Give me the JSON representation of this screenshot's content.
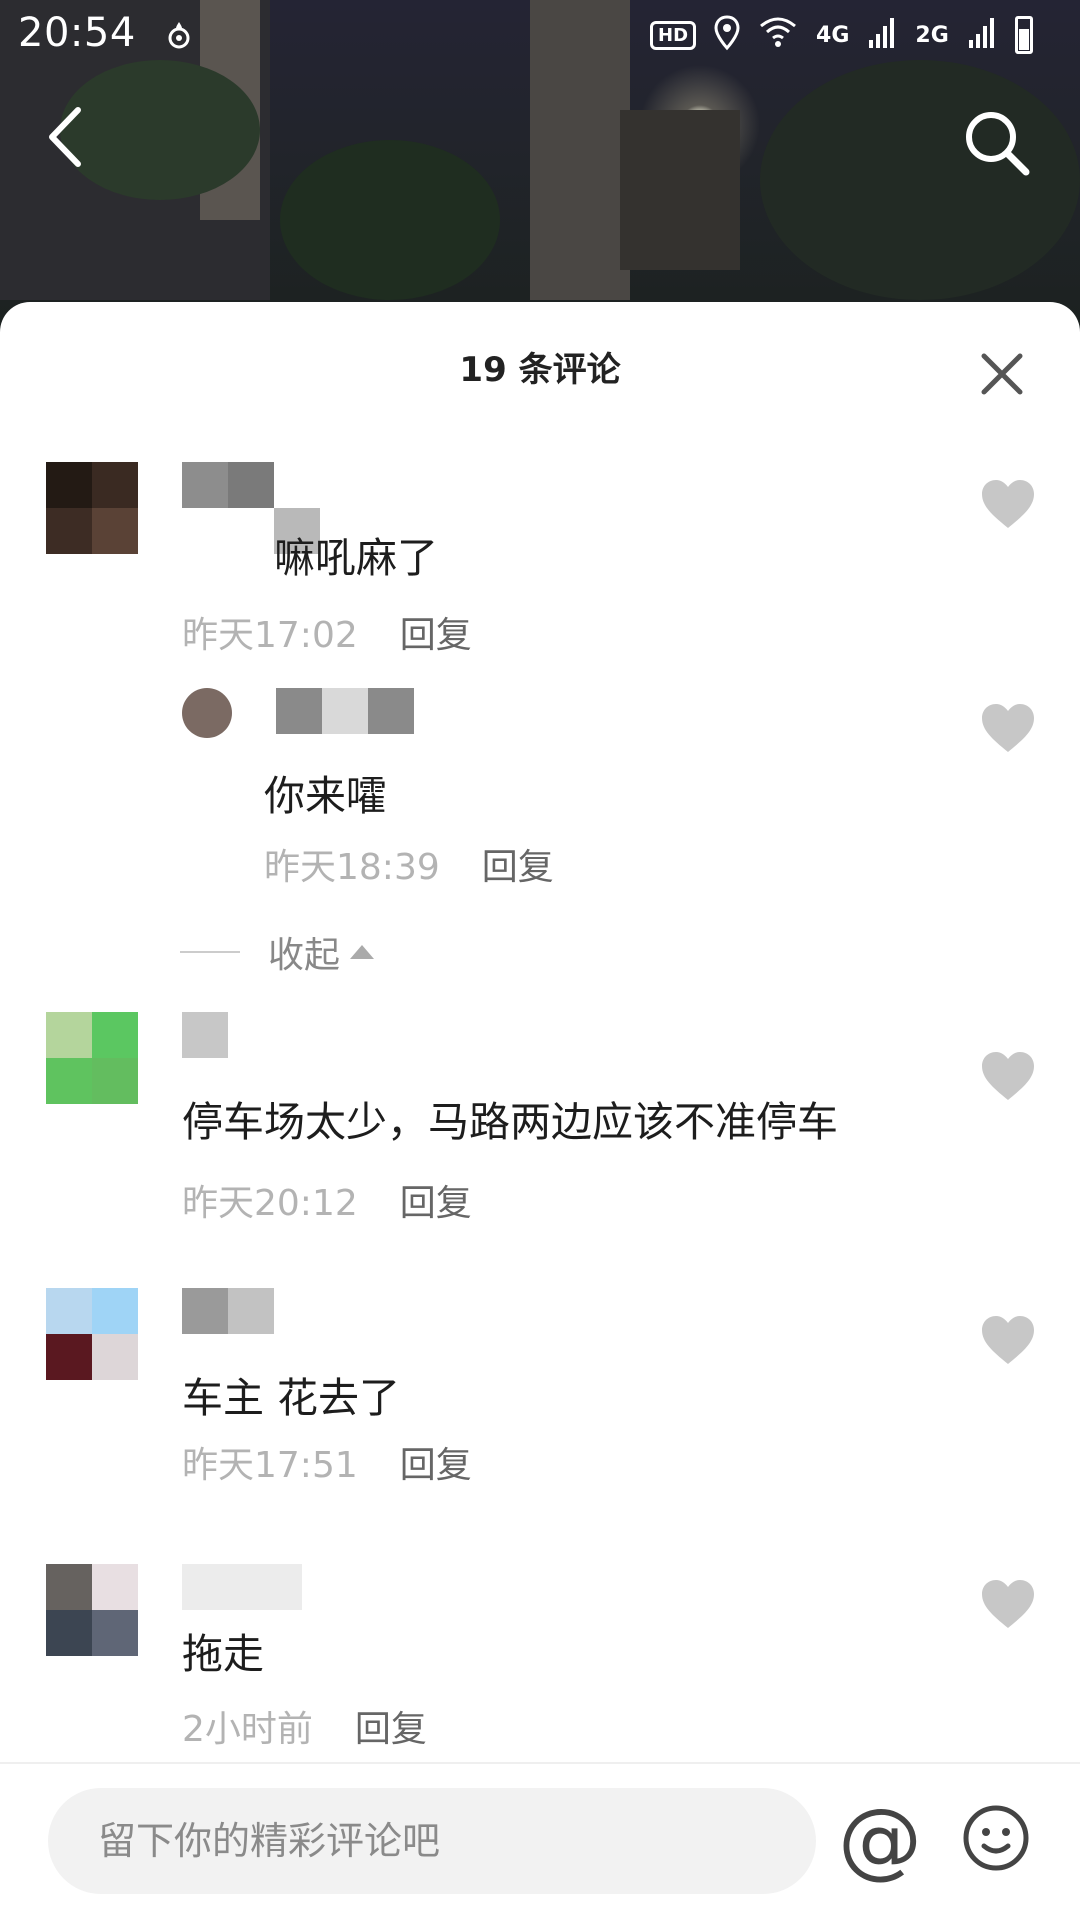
{
  "status_bar": {
    "time": "20:54",
    "hd": "HD",
    "net_4g": "4G",
    "net_2g": "2G"
  },
  "header": {
    "back_icon": "chevron-left-icon",
    "search_icon": "search-icon"
  },
  "sheet": {
    "title": "19 条评论",
    "comments": [
      {
        "text": "嘛吼麻了",
        "time": "昨天17:02",
        "reply": "回复"
      },
      {
        "text": "你来嚯",
        "time": "昨天18:39",
        "reply": "回复"
      },
      {
        "text": "停车场太少，马路两边应该不准停车",
        "time": "昨天20:12",
        "reply": "回复"
      },
      {
        "text": "车主 花去了",
        "time": "昨天17:51",
        "reply": "回复"
      },
      {
        "text": "拖走",
        "time": "2小时前",
        "reply": "回复"
      }
    ],
    "collapse_label": "收起"
  },
  "composer": {
    "placeholder": "留下你的精彩评论吧",
    "at_label": "@"
  },
  "colors": {
    "like": "#c7c7c7",
    "timestamp": "#b3b3b3",
    "reply": "#666666",
    "input_bg": "#f2f2f2"
  }
}
